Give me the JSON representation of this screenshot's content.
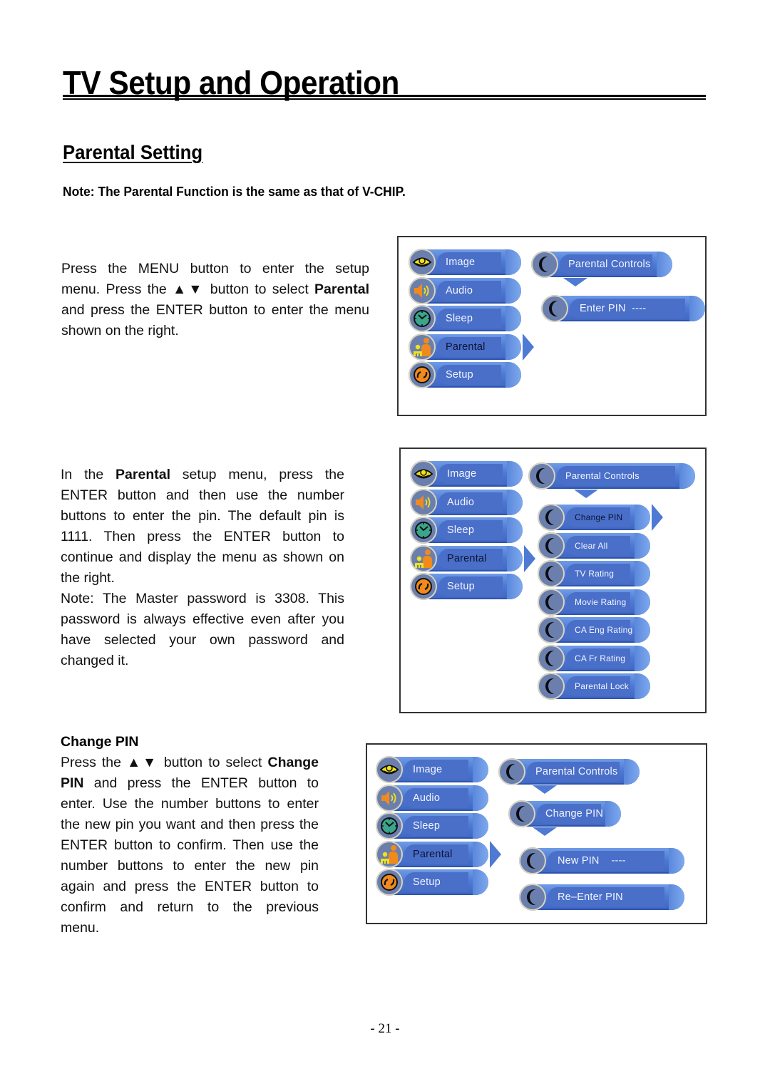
{
  "page": {
    "title": "TV Setup and Operation",
    "section_title": "Parental Setting",
    "note": "Note: The Parental Function is the same as that of V-CHIP.",
    "page_number": "- 21 -"
  },
  "paragraphs": {
    "p1_lines": [
      "Press the MENU button to enter the setup",
      {
        "pre": "menu. Press the ▲▼ button to select ",
        "bold": "Parental"
      },
      "and press the ENTER button to enter the menu",
      "shown on the right."
    ],
    "p2_lines": [
      {
        "pre": "In the ",
        "bold": "Parental",
        "post": " setup menu, press the"
      },
      "ENTER button and then use the number",
      "buttons to enter the pin. The default pin is",
      "1111. Then press the ENTER button to",
      "continue and display the menu as shown on",
      "the right."
    ],
    "p3_lines": [
      "Note: The Master password is 3308. This",
      "password is always effective even after you",
      "have selected your own password and",
      "changed it."
    ],
    "change_pin_heading": "Change PIN",
    "p4_lines": [
      {
        "pre": "Press the ▲▼ button to select ",
        "bold": "Change"
      },
      {
        "bold": "PIN",
        "post": " and press the ENTER button to"
      },
      "enter. Use the number buttons to enter",
      "the new pin you want and then press the",
      "ENTER button to confirm. Then use the",
      "number buttons to enter the new pin",
      "again and press the ENTER button to",
      "confirm and return to the previous",
      "menu."
    ]
  },
  "main_menu": {
    "items": [
      {
        "label": "Image",
        "icon": "eye-icon"
      },
      {
        "label": "Audio",
        "icon": "speaker-icon"
      },
      {
        "label": "Sleep",
        "icon": "clock-icon"
      },
      {
        "label": "Parental",
        "icon": "parent-child-icon",
        "selected": true
      },
      {
        "label": "Setup",
        "icon": "wrench-icon"
      }
    ]
  },
  "screen1": {
    "header": "Parental Controls",
    "pin_label": "Enter PIN",
    "pin_value": "----"
  },
  "screen2": {
    "header": "Parental Controls",
    "items": [
      "Change PIN",
      "Clear All",
      "TV Rating",
      "Movie Rating",
      "CA Eng Rating",
      "CA Fr Rating",
      "Parental Lock"
    ],
    "selected_index": 0
  },
  "screen3": {
    "header": "Parental Controls",
    "sub_header": "Change PIN",
    "new_pin_label": "New PIN",
    "new_pin_value": "----",
    "reenter_label": "Re–Enter PIN"
  },
  "colors": {
    "menu_blue": "#4f7ad4",
    "knob": "#6a7fad",
    "icon_yellow": "#f2e21a",
    "icon_orange": "#f08a1c",
    "icon_green": "#3aa58a"
  }
}
